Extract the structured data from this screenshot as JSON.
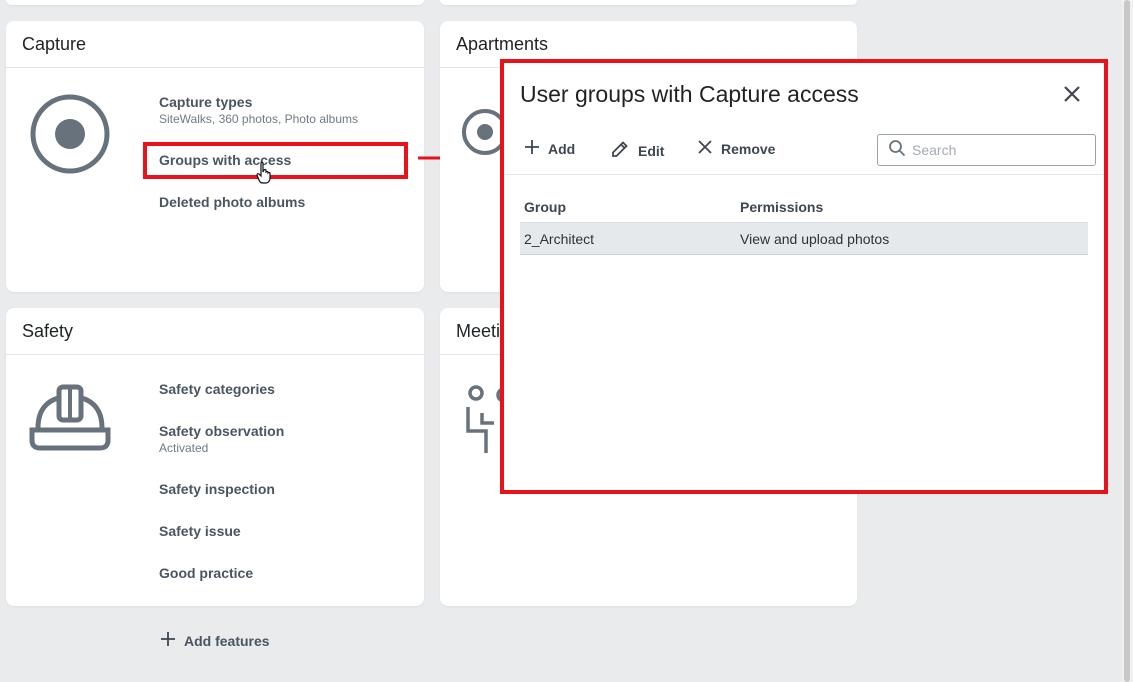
{
  "colors": {
    "accent_red": "#e8121a",
    "icon_gray": "#68727c"
  },
  "capture": {
    "title": "Capture",
    "icon": "capture-record-icon",
    "items": [
      {
        "label": "Capture types",
        "sub": "SiteWalks, 360 photos, Photo albums"
      },
      {
        "label": "Groups with access"
      },
      {
        "label": "Deleted photo albums"
      }
    ]
  },
  "apartments": {
    "title": "Apartments"
  },
  "safety": {
    "title": "Safety",
    "icon": "hard-hat-icon",
    "items": [
      {
        "label": "Safety categories"
      },
      {
        "label": "Safety observation",
        "sub": "Activated"
      },
      {
        "label": "Safety inspection"
      },
      {
        "label": "Safety issue"
      },
      {
        "label": "Good practice"
      }
    ]
  },
  "meetings": {
    "title": "Meeti"
  },
  "add_features": {
    "label": "Add features",
    "icon": "plus-icon"
  },
  "dialog": {
    "title": "User groups with Capture access",
    "toolbar": {
      "add_label": "Add",
      "edit_label": "Edit",
      "remove_label": "Remove",
      "search_placeholder": "Search"
    },
    "table": {
      "headers": [
        "Group",
        "Permissions"
      ],
      "rows": [
        {
          "group": "2_Architect",
          "permissions": "View and upload photos"
        }
      ]
    }
  }
}
